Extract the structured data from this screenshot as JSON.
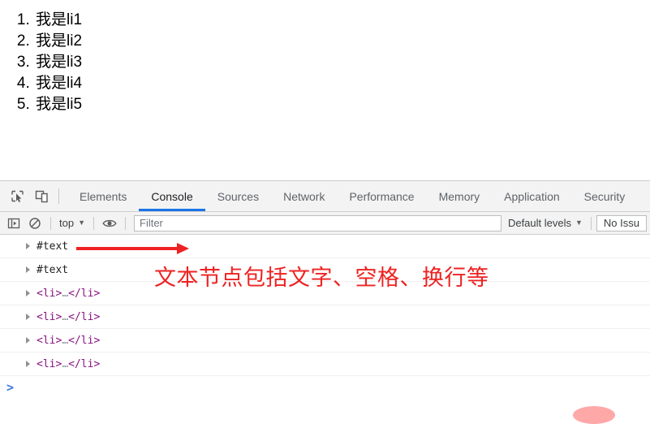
{
  "page": {
    "list_items": [
      "我是li1",
      "我是li2",
      "我是li3",
      "我是li4",
      "我是li5"
    ]
  },
  "devtools": {
    "icons": {
      "inspect": "inspect-element-icon",
      "device": "device-toolbar-icon",
      "sidebar": "console-sidebar-icon",
      "clear": "clear-console-icon",
      "eye": "live-expression-icon"
    },
    "tabs": [
      {
        "label": "Elements",
        "active": false
      },
      {
        "label": "Console",
        "active": true
      },
      {
        "label": "Sources",
        "active": false
      },
      {
        "label": "Network",
        "active": false
      },
      {
        "label": "Performance",
        "active": false
      },
      {
        "label": "Memory",
        "active": false
      },
      {
        "label": "Application",
        "active": false
      },
      {
        "label": "Security",
        "active": false
      }
    ],
    "console_toolbar": {
      "context": "top",
      "caret": "▼",
      "filter_placeholder": "Filter",
      "filter_value": "",
      "levels_label": "Default levels",
      "levels_caret": "▼",
      "issues_label": "No Issu"
    },
    "messages": [
      {
        "type": "text",
        "label": "#text"
      },
      {
        "type": "text",
        "label": "#text"
      },
      {
        "type": "element",
        "open": "<li>",
        "ellipsis": "…",
        "close": "</li>"
      },
      {
        "type": "element",
        "open": "<li>",
        "ellipsis": "…",
        "close": "</li>"
      },
      {
        "type": "element",
        "open": "<li>",
        "ellipsis": "…",
        "close": "</li>"
      },
      {
        "type": "element",
        "open": "<li>",
        "ellipsis": "…",
        "close": "</li>"
      }
    ],
    "prompt": ">"
  },
  "annotations": {
    "note_text": "文本节点包括文字、空格、换行等",
    "arrow_color": "#ee2222",
    "note_color": "#ee2222",
    "blob_color": "#ff9999"
  }
}
